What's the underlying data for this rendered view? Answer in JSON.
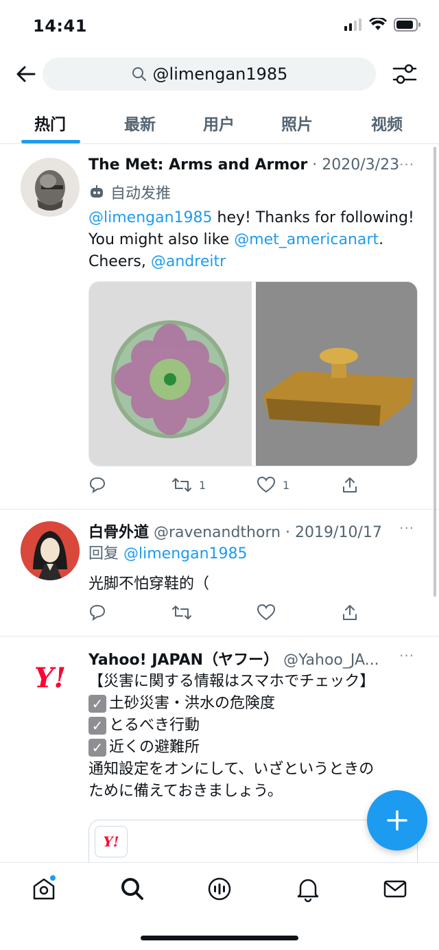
{
  "status": {
    "time": "14:41"
  },
  "search": {
    "query": "@limengan1985"
  },
  "tabs": [
    "热门",
    "最新",
    "用户",
    "照片",
    "视频"
  ],
  "tweets": [
    {
      "name": "The Met: Arms and Armor",
      "meta": "· 2020/3/23",
      "more": "···",
      "automated_label": "自动发推",
      "mention": "@limengan1985",
      "text1": " hey! Thanks for following!",
      "text2": "You might also like ",
      "link2": "@met_americanart",
      "text2b": ".",
      "text3": "Cheers, ",
      "link3": "@andreitr",
      "reply_count": "",
      "retweet_count": "1",
      "like_count": "1"
    },
    {
      "name": "白骨外道",
      "meta": "@ravenandthorn · 2019/10/17",
      "more": "···",
      "reply_prefix": "回复 ",
      "reply_to": "@limengan1985",
      "text": "光脚不怕穿鞋的（"
    },
    {
      "name": "Yahoo! JAPAN（ヤフー）",
      "meta": "@Yahoo_JA...",
      "more": "···",
      "logo_text": "Y!",
      "line1": "【災害に関する情報はスマホでチェック】",
      "line2": "土砂災害・洪水の危険度",
      "line3": "とるべき行動",
      "line4": "近くの避難所",
      "line5": "通知設定をオンにして、いざというときの",
      "line6": "ために備えておきましょう。",
      "card_logo": "Y!"
    }
  ],
  "colors": {
    "accent": "#1d9bf0",
    "text": "#0f1419",
    "muted": "#536471",
    "yahoo_red": "#ff0033"
  },
  "icons": [
    "back-arrow-icon",
    "search-icon",
    "filter-icon",
    "more-icon",
    "reply-icon",
    "retweet-icon",
    "like-icon",
    "share-icon",
    "home-icon",
    "explore-icon",
    "spaces-icon",
    "notifications-icon",
    "messages-icon",
    "compose-icon"
  ]
}
